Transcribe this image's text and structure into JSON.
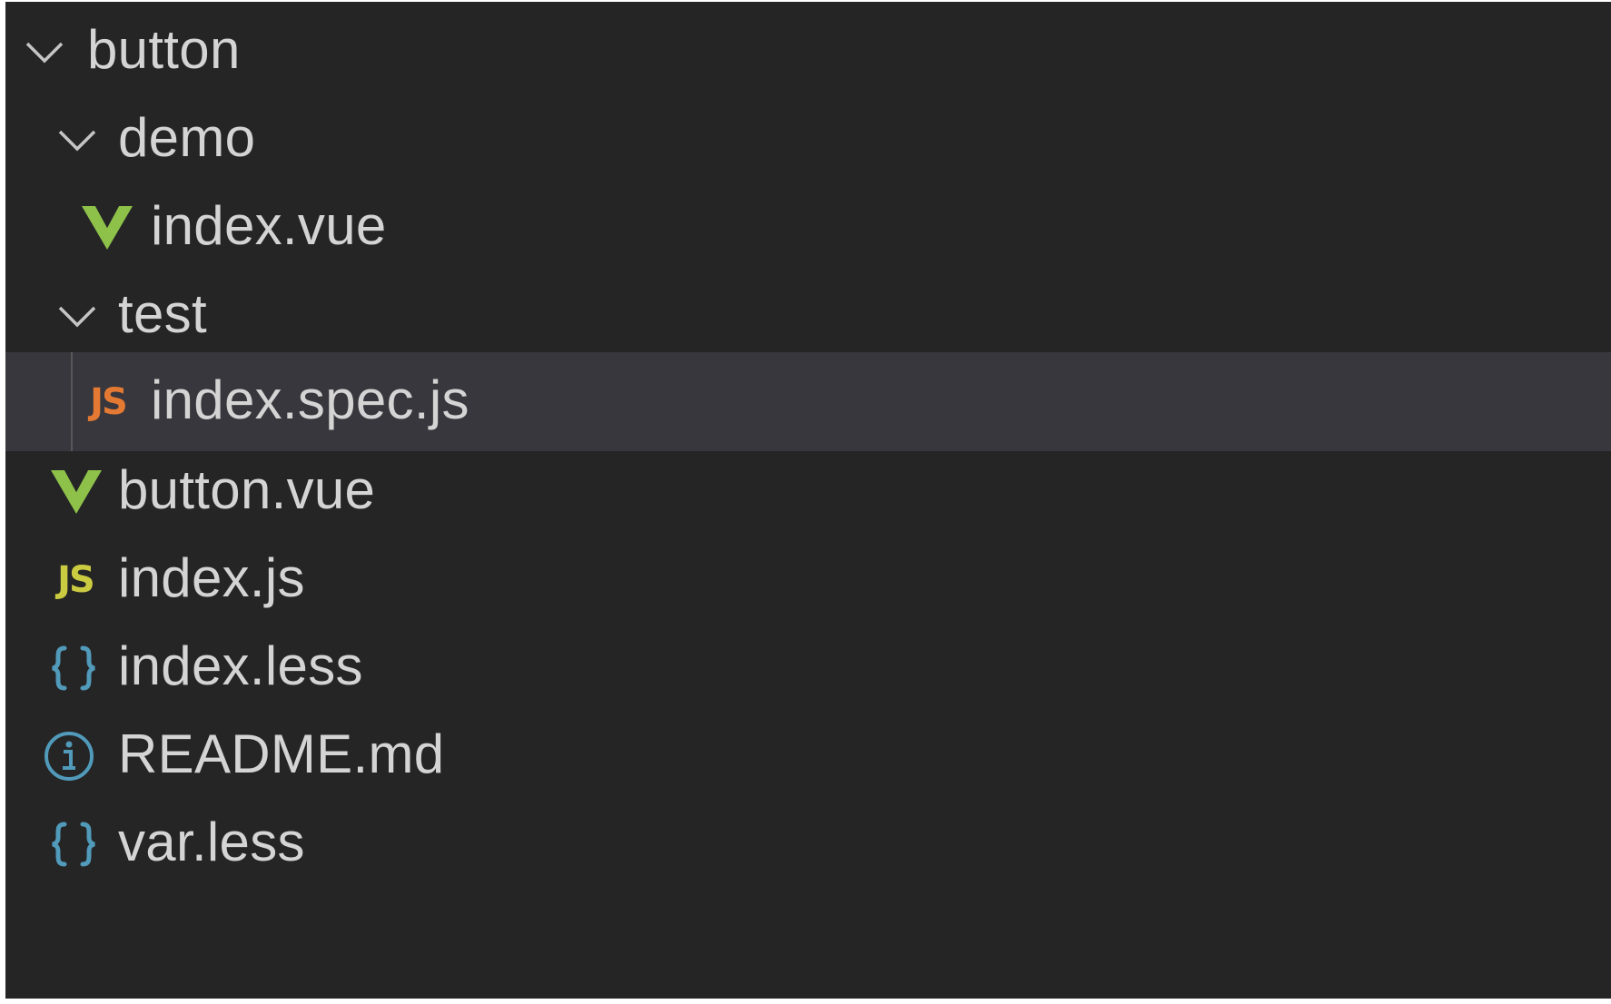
{
  "explorer": {
    "items": [
      {
        "label": "button",
        "kind": "folder",
        "expanded": true,
        "depth": 0,
        "icon": "chevron-down-icon"
      },
      {
        "label": "demo",
        "kind": "folder",
        "expanded": true,
        "depth": 1,
        "icon": "chevron-down-icon"
      },
      {
        "label": "index.vue",
        "kind": "file",
        "depth": 2,
        "icon": "vue-icon"
      },
      {
        "label": "test",
        "kind": "folder",
        "expanded": true,
        "depth": 1,
        "icon": "chevron-down-icon"
      },
      {
        "label": "index.spec.js",
        "kind": "file",
        "depth": 2,
        "icon": "js-test-icon",
        "selected": true
      },
      {
        "label": "button.vue",
        "kind": "file",
        "depth": 1,
        "icon": "vue-icon"
      },
      {
        "label": "index.js",
        "kind": "file",
        "depth": 1,
        "icon": "js-icon"
      },
      {
        "label": "index.less",
        "kind": "file",
        "depth": 1,
        "icon": "less-braces-icon"
      },
      {
        "label": "README.md",
        "kind": "file",
        "depth": 1,
        "icon": "info-icon"
      },
      {
        "label": "var.less",
        "kind": "file",
        "depth": 1,
        "icon": "less-braces-icon"
      }
    ]
  },
  "icons": {
    "js_test_text": "JS",
    "js_text": "JS"
  },
  "colors": {
    "background": "#252526",
    "selected_row": "#37373d",
    "text": "#d4d4d4",
    "chevron": "#c5c5c5",
    "vue_green": "#8dc149",
    "js_orange": "#e37933",
    "js_yellow": "#cbcb41",
    "less_blue": "#519aba",
    "info_blue": "#519aba"
  }
}
